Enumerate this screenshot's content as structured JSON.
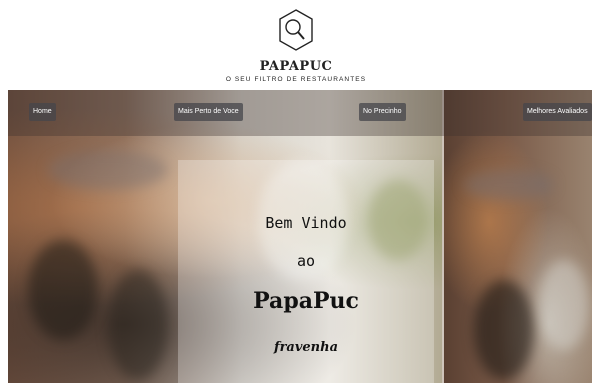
{
  "header": {
    "logo_icon": "magnifier-hexagon-icon",
    "brand": "PAPAPUC",
    "tagline": "O SEU FILTRO DE RESTAURANTES"
  },
  "nav": {
    "home": "Home",
    "perto": "Mais Perto de Voce",
    "precinho": "No Precinho",
    "avaliados": "Melhores Avaliados"
  },
  "welcome": {
    "line1": "Bem Vindo",
    "line2": "ao",
    "line3": "PapaPuc",
    "line4": "fravenha"
  },
  "colors": {
    "nav_button_bg": "#46464b",
    "text_dark": "#111111"
  }
}
